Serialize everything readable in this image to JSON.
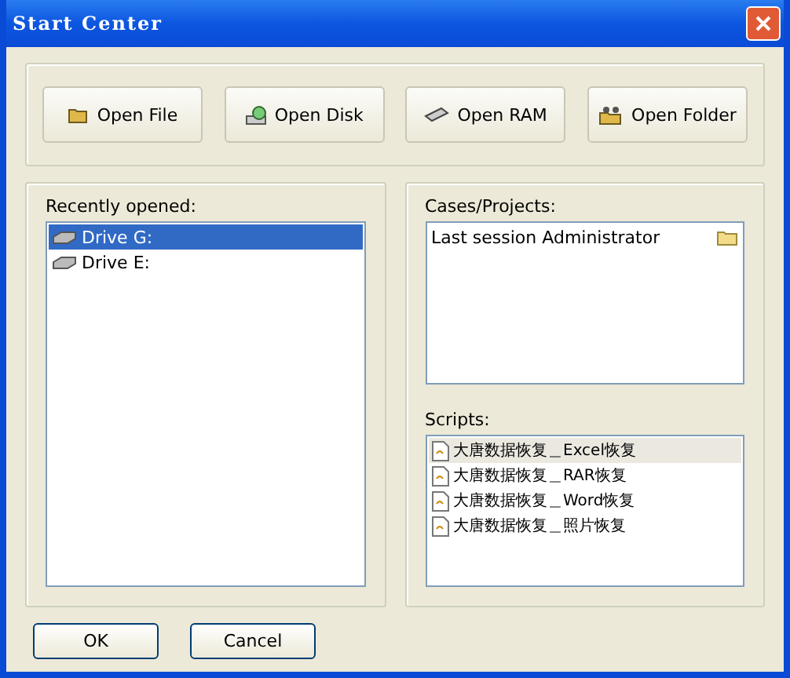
{
  "window": {
    "title": "Start Center"
  },
  "open_buttons": [
    {
      "label": "Open File",
      "kind": "file"
    },
    {
      "label": "Open Disk",
      "kind": "disk"
    },
    {
      "label": "Open RAM",
      "kind": "ram"
    },
    {
      "label": "Open Folder",
      "kind": "folder"
    }
  ],
  "recent": {
    "label": "Recently opened:",
    "items": [
      {
        "label": "Drive G:",
        "selected": true
      },
      {
        "label": "Drive E:",
        "selected": false
      }
    ]
  },
  "cases": {
    "label": "Cases/Projects:",
    "items": [
      {
        "label": "Last session Administrator",
        "selected": false
      }
    ]
  },
  "scripts": {
    "label": "Scripts:",
    "items": [
      {
        "label": "大唐数据恢复＿Excel恢复",
        "selected": true
      },
      {
        "label": "大唐数据恢复＿RAR恢复",
        "selected": false
      },
      {
        "label": "大唐数据恢复＿Word恢复",
        "selected": false
      },
      {
        "label": "大唐数据恢复＿照片恢复",
        "selected": false
      }
    ]
  },
  "buttons": [
    {
      "label": "OK"
    },
    {
      "label": "Cancel"
    }
  ]
}
